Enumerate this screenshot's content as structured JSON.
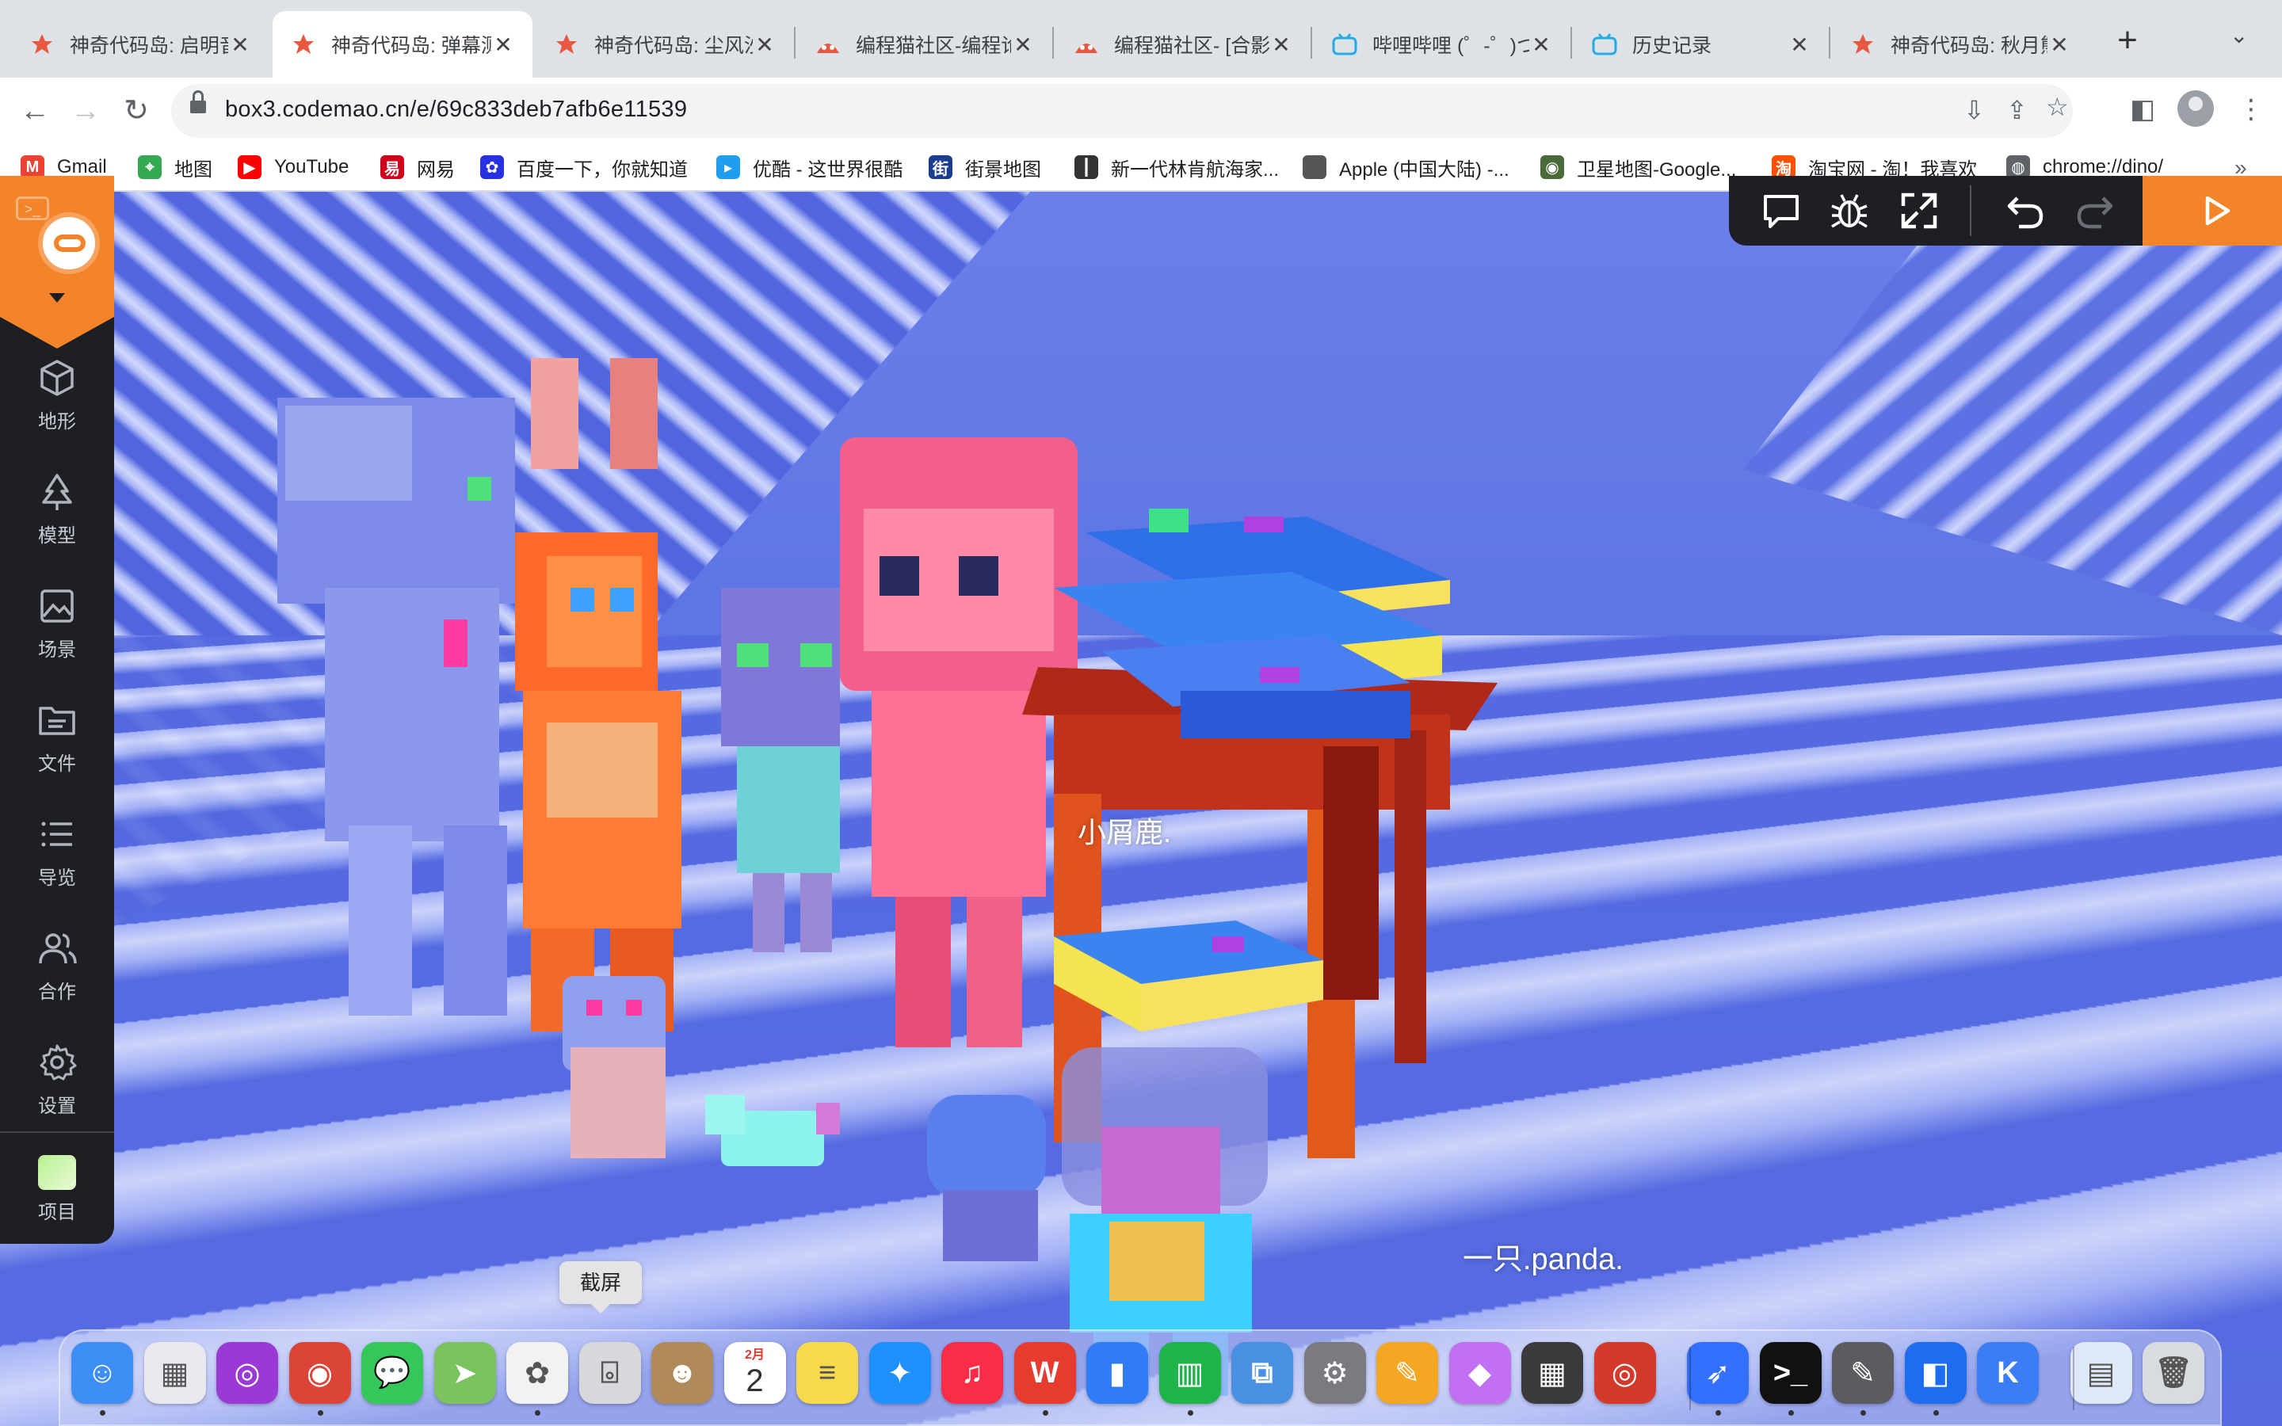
{
  "browser": {
    "tabs": [
      {
        "title": "神奇代码岛: 启明音",
        "favicon": "codemao-star-icon",
        "active": false
      },
      {
        "title": "神奇代码岛: 弹幕测",
        "favicon": "codemao-star-icon",
        "active": true
      },
      {
        "title": "神奇代码岛: 尘风沙",
        "favicon": "codemao-star-icon",
        "active": false
      },
      {
        "title": "编程猫社区-编程论",
        "favicon": "codemao-cat-icon",
        "active": false
      },
      {
        "title": "编程猫社区- [合影",
        "favicon": "codemao-cat-icon",
        "active": false
      },
      {
        "title": "哔哩哔哩 (゜-゜)つ",
        "favicon": "bilibili-icon",
        "active": false
      },
      {
        "title": "历史记录",
        "favicon": "bilibili-icon",
        "active": false
      },
      {
        "title": "神奇代码岛: 秋月熊",
        "favicon": "codemao-star-icon",
        "active": false
      }
    ],
    "url": "box3.codemao.cn/e/69c833deb7afb6e11539",
    "bookmarks": [
      {
        "label": "Gmail",
        "icon": "gmail-icon",
        "color": "#ea4335",
        "glyph": "M"
      },
      {
        "label": "地图",
        "icon": "maps-icon",
        "color": "#34a853",
        "glyph": "⌖"
      },
      {
        "label": "YouTube",
        "icon": "youtube-icon",
        "color": "#ff0000",
        "glyph": "▶"
      },
      {
        "label": "网易",
        "icon": "netease-icon",
        "color": "#d0021b",
        "glyph": "易"
      },
      {
        "label": "百度一下，你就知道",
        "icon": "baidu-icon",
        "color": "#2932e1",
        "glyph": "✿"
      },
      {
        "label": "优酷 - 这世界很酷",
        "icon": "youku-icon",
        "color": "#1f9ef0",
        "glyph": "▸"
      },
      {
        "label": "街景地图",
        "icon": "streetview-icon",
        "color": "#1a3d8f",
        "glyph": "街"
      },
      {
        "label": "新一代林肯航海家...",
        "icon": "lincoln-icon",
        "color": "#333333",
        "glyph": "┃"
      },
      {
        "label": "Apple (中国大陆) -...",
        "icon": "apple-icon",
        "color": "#555555",
        "glyph": ""
      },
      {
        "label": "卫星地图-Google...",
        "icon": "globe-icon",
        "color": "#4a6a3a",
        "glyph": "◉"
      },
      {
        "label": "淘宝网 - 淘！我喜欢",
        "icon": "taobao-icon",
        "color": "#ff5000",
        "glyph": "淘"
      },
      {
        "label": "chrome://dino/",
        "icon": "world-icon",
        "color": "#5f6368",
        "glyph": "◍"
      }
    ]
  },
  "editor": {
    "sidebar": [
      {
        "label": "地形",
        "icon": "cube-icon"
      },
      {
        "label": "模型",
        "icon": "tree-icon"
      },
      {
        "label": "场景",
        "icon": "image-icon"
      },
      {
        "label": "文件",
        "icon": "folder-icon"
      },
      {
        "label": "导览",
        "icon": "list-icon"
      },
      {
        "label": "合作",
        "icon": "users-icon"
      },
      {
        "label": "设置",
        "icon": "gear-icon"
      }
    ],
    "project_label": "项目",
    "toolbar_icons": [
      "chat-icon",
      "bug-icon",
      "expand-icon",
      "undo-icon",
      "redo-icon",
      "play-icon"
    ]
  },
  "scene": {
    "name_tag_1": "小屑鹿.",
    "name_tag_2": "一只.panda."
  },
  "tooltip": "截屏",
  "dock": {
    "calendar_month": "2月",
    "calendar_day": "2",
    "apps": [
      {
        "name": "finder-icon",
        "color": "#3d8ef5",
        "glyph": "☺"
      },
      {
        "name": "launchpad-icon",
        "color": "#e8e8ee",
        "glyph": "▦"
      },
      {
        "name": "podcasts-icon",
        "color": "#9b39d6",
        "glyph": "◎"
      },
      {
        "name": "chrome-icon",
        "color": "#db4437",
        "glyph": "◉"
      },
      {
        "name": "messages-icon",
        "color": "#34c759",
        "glyph": "💬"
      },
      {
        "name": "maps-app-icon",
        "color": "#7ac35e",
        "glyph": "➤"
      },
      {
        "name": "photos-icon",
        "color": "#f2f2f2",
        "glyph": "✿"
      },
      {
        "name": "screenshot-icon",
        "color": "#d8d8dc",
        "glyph": "⌻"
      },
      {
        "name": "contacts-icon",
        "color": "#b08a5a",
        "glyph": "☻"
      },
      {
        "name": "calendar-icon",
        "color": "#ffffff",
        "glyph": ""
      },
      {
        "name": "notes-icon",
        "color": "#f7d94c",
        "glyph": "≡"
      },
      {
        "name": "safari-icon",
        "color": "#1e90ff",
        "glyph": "✦"
      },
      {
        "name": "music-icon",
        "color": "#fa2d48",
        "glyph": "♫"
      },
      {
        "name": "wps-icon",
        "color": "#e63c2f",
        "glyph": "W"
      },
      {
        "name": "keynote-icon",
        "color": "#2f7cf6",
        "glyph": "▮"
      },
      {
        "name": "numbers-icon",
        "color": "#1fb44a",
        "glyph": "▥"
      },
      {
        "name": "screen-capture-icon",
        "color": "#4a90e2",
        "glyph": "⧉"
      },
      {
        "name": "system-preferences-icon",
        "color": "#7a7a80",
        "glyph": "⚙"
      },
      {
        "name": "pages-icon",
        "color": "#f5a623",
        "glyph": "✎"
      },
      {
        "name": "paint-icon",
        "color": "#c070f0",
        "glyph": "◆"
      },
      {
        "name": "calculator-icon",
        "color": "#3a3a3c",
        "glyph": "▦"
      },
      {
        "name": "instruments-icon",
        "color": "#d43a2a",
        "glyph": "◎"
      },
      {
        "name": "feishu-icon",
        "color": "#3370ff",
        "glyph": "➶"
      },
      {
        "name": "terminal-icon",
        "color": "#111111",
        "glyph": ">_"
      },
      {
        "name": "script-editor-icon",
        "color": "#5b5b60",
        "glyph": "✎"
      },
      {
        "name": "xcode-like-icon",
        "color": "#1e6cf0",
        "glyph": "◧"
      },
      {
        "name": "k-app-icon",
        "color": "#3b7df5",
        "glyph": "K"
      },
      {
        "name": "downloads-stack-icon",
        "color": "#dfe8f7",
        "glyph": "▤"
      },
      {
        "name": "trash-icon",
        "color": "#d8dbe0",
        "glyph": "🗑"
      }
    ]
  }
}
